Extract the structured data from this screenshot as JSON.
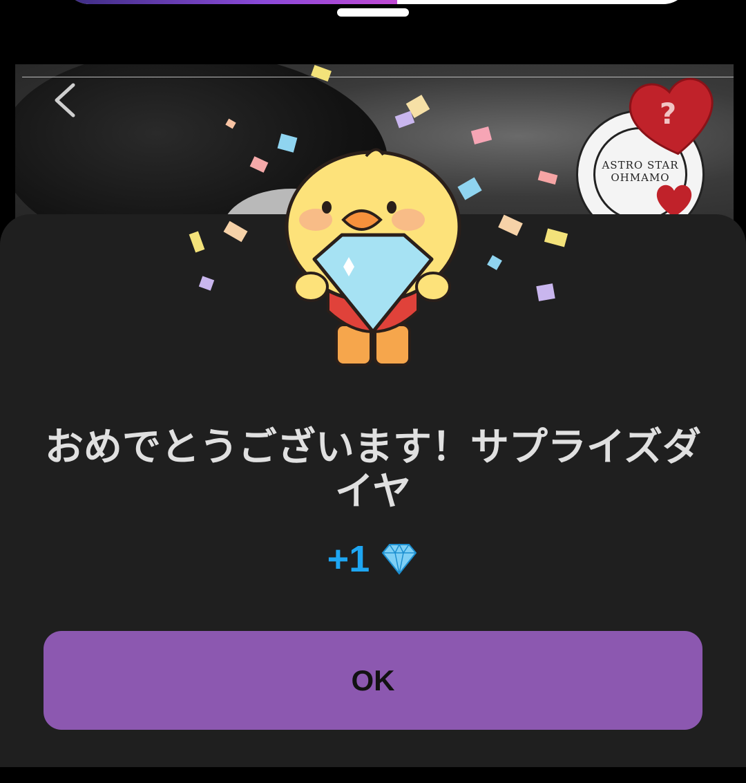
{
  "dialog": {
    "title": "おめでとうございます！サプライズダイヤ",
    "reward_amount": "+1",
    "reward_icon": "diamond-icon",
    "ok_label": "OK"
  },
  "background": {
    "stamp_text": "ASTRO STAR OHMAMO",
    "mystery_badge": "?",
    "back_icon": "chevron-left-icon"
  },
  "colors": {
    "sheet": "#1f1f1f",
    "button": "#8c58b0",
    "reward": "#1ea6f2",
    "heart": "#c0222a"
  }
}
